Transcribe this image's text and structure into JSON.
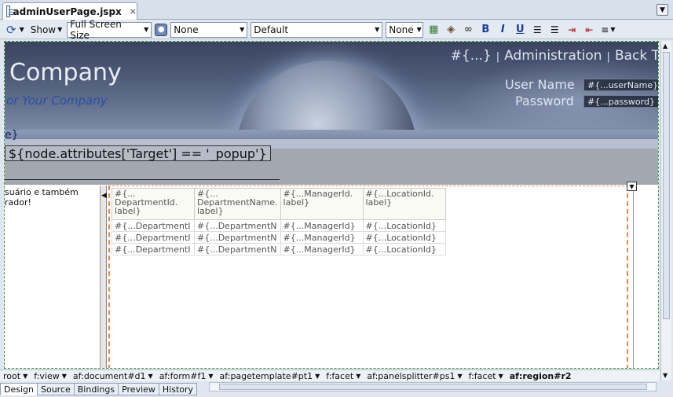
{
  "tab": {
    "title": "adminUserPage.jspx",
    "close": "×"
  },
  "toolbar": {
    "show_label": "Show",
    "screen_size": "Full Screen Size",
    "style_dropdown": "None",
    "css_dropdown": "Default",
    "font_dropdown": "None"
  },
  "banner": {
    "company": "Company",
    "slogan": "or Your Company",
    "nav_expr": "#{...}",
    "nav_admin": "Administration",
    "nav_back": "Back T",
    "username_label": "User Name",
    "username_value": "#{...userName}",
    "password_label": "Password",
    "password_value": "#{...password}"
  },
  "page": {
    "el_fragment": "e}",
    "target_expr": "${node.attributes['Target'] == '_popup'}"
  },
  "left_panel": {
    "line1": "suário e também",
    "line2": "rador!"
  },
  "table": {
    "headers": [
      "#{... DepartmentId. label}",
      "#{... DepartmentName. label}",
      "#{...ManagerId. label}",
      "#{...LocationId. label}"
    ],
    "rows": [
      [
        "#{...DepartmentI",
        "#{...DepartmentN",
        "#{...ManagerId}",
        "#{...LocationId}"
      ],
      [
        "#{...DepartmentI",
        "#{...DepartmentN",
        "#{...ManagerId}",
        "#{...LocationId}"
      ],
      [
        "#{...DepartmentI",
        "#{...DepartmentN",
        "#{...ManagerId}",
        "#{...LocationId}"
      ]
    ]
  },
  "breadcrumbs": [
    "root",
    "f:view",
    "af:document#d1",
    "af:form#f1",
    "af:pagetemplate#pt1",
    "f:facet",
    "af:panelsplitter#ps1",
    "f:facet",
    "af:region#r2"
  ],
  "bottom_tabs": [
    "Design",
    "Source",
    "Bindings",
    "Preview",
    "History"
  ]
}
